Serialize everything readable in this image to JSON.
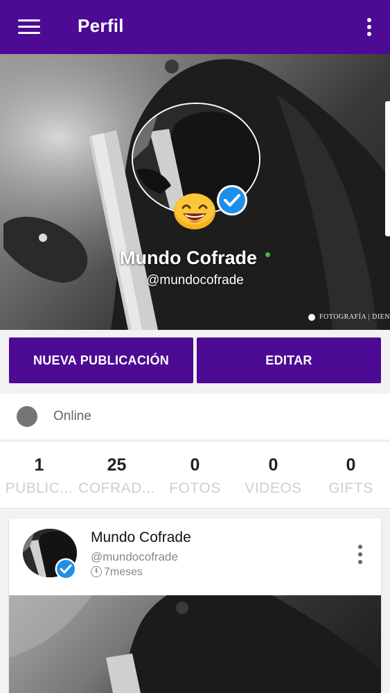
{
  "appbar": {
    "title": "Perfil",
    "menu_icon": "hamburger-menu-icon",
    "more_icon": "more-vert-icon",
    "color": "#4d0a94"
  },
  "profile": {
    "name": "Mundo Cofrade",
    "handle": "@mundocofrade",
    "online_indicator_color": "#3ac13a",
    "watermark": "FOTOGRAFÍA | DIEN"
  },
  "actions": {
    "new_post": "NUEVA PUBLICACIÓN",
    "edit": "EDITAR"
  },
  "status": {
    "label": "Online",
    "dot_color": "#757575"
  },
  "stats": [
    {
      "value": "1",
      "label": "PUBLIC..."
    },
    {
      "value": "25",
      "label": "COFRAD..."
    },
    {
      "value": "0",
      "label": "FOTOS"
    },
    {
      "value": "0",
      "label": "VIDEOS"
    },
    {
      "value": "0",
      "label": "GIFTS"
    }
  ],
  "post": {
    "name": "Mundo Cofrade",
    "handle": "@mundocofrade",
    "time": "7meses"
  }
}
